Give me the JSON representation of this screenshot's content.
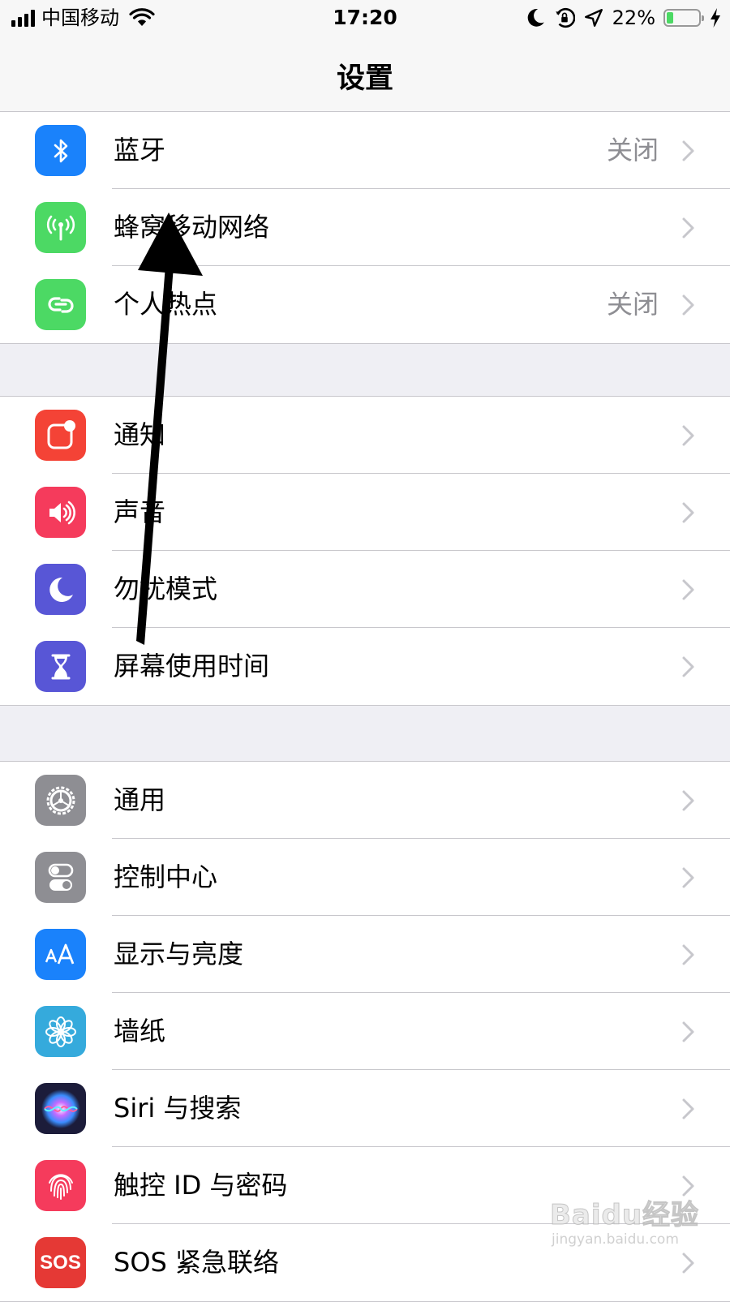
{
  "status_bar": {
    "carrier": "中国移动",
    "time": "17:20",
    "battery_percent": "22%",
    "battery_level": 0.22
  },
  "nav": {
    "title": "设置"
  },
  "groups": [
    [
      {
        "label": "蓝牙",
        "value": "关闭",
        "icon": "bluetooth-icon",
        "color": "#1a82fb"
      },
      {
        "label": "蜂窝移动网络",
        "value": "",
        "icon": "cellular-antenna-icon",
        "color": "#4cd964"
      },
      {
        "label": "个人热点",
        "value": "关闭",
        "icon": "hotspot-link-icon",
        "color": "#4cd964"
      }
    ],
    [
      {
        "label": "通知",
        "value": "",
        "icon": "notification-icon",
        "color": "#f44336"
      },
      {
        "label": "声音",
        "value": "",
        "icon": "speaker-icon",
        "color": "#f53b5c"
      },
      {
        "label": "勿扰模式",
        "value": "",
        "icon": "moon-icon",
        "color": "#5856d6"
      },
      {
        "label": "屏幕使用时间",
        "value": "",
        "icon": "hourglass-icon",
        "color": "#5856d6"
      }
    ],
    [
      {
        "label": "通用",
        "value": "",
        "icon": "gear-icon",
        "color": "#8e8e93"
      },
      {
        "label": "控制中心",
        "value": "",
        "icon": "toggles-icon",
        "color": "#8e8e93"
      },
      {
        "label": "显示与亮度",
        "value": "",
        "icon": "text-size-icon",
        "color": "#1a82fb"
      },
      {
        "label": "墙纸",
        "value": "",
        "icon": "flower-icon",
        "color": "#35aadc"
      },
      {
        "label": "Siri 与搜索",
        "value": "",
        "icon": "siri-icon",
        "color": "#1c1c3a"
      },
      {
        "label": "触控 ID 与密码",
        "value": "",
        "icon": "fingerprint-icon",
        "color": "#f53b5c"
      },
      {
        "label": "SOS 紧急联络",
        "value": "",
        "icon": "sos-icon",
        "color": "#e53935",
        "icon_text": "SOS"
      }
    ]
  ],
  "watermark": {
    "logo": "Baidu经验",
    "url": "jingyan.baidu.com"
  }
}
